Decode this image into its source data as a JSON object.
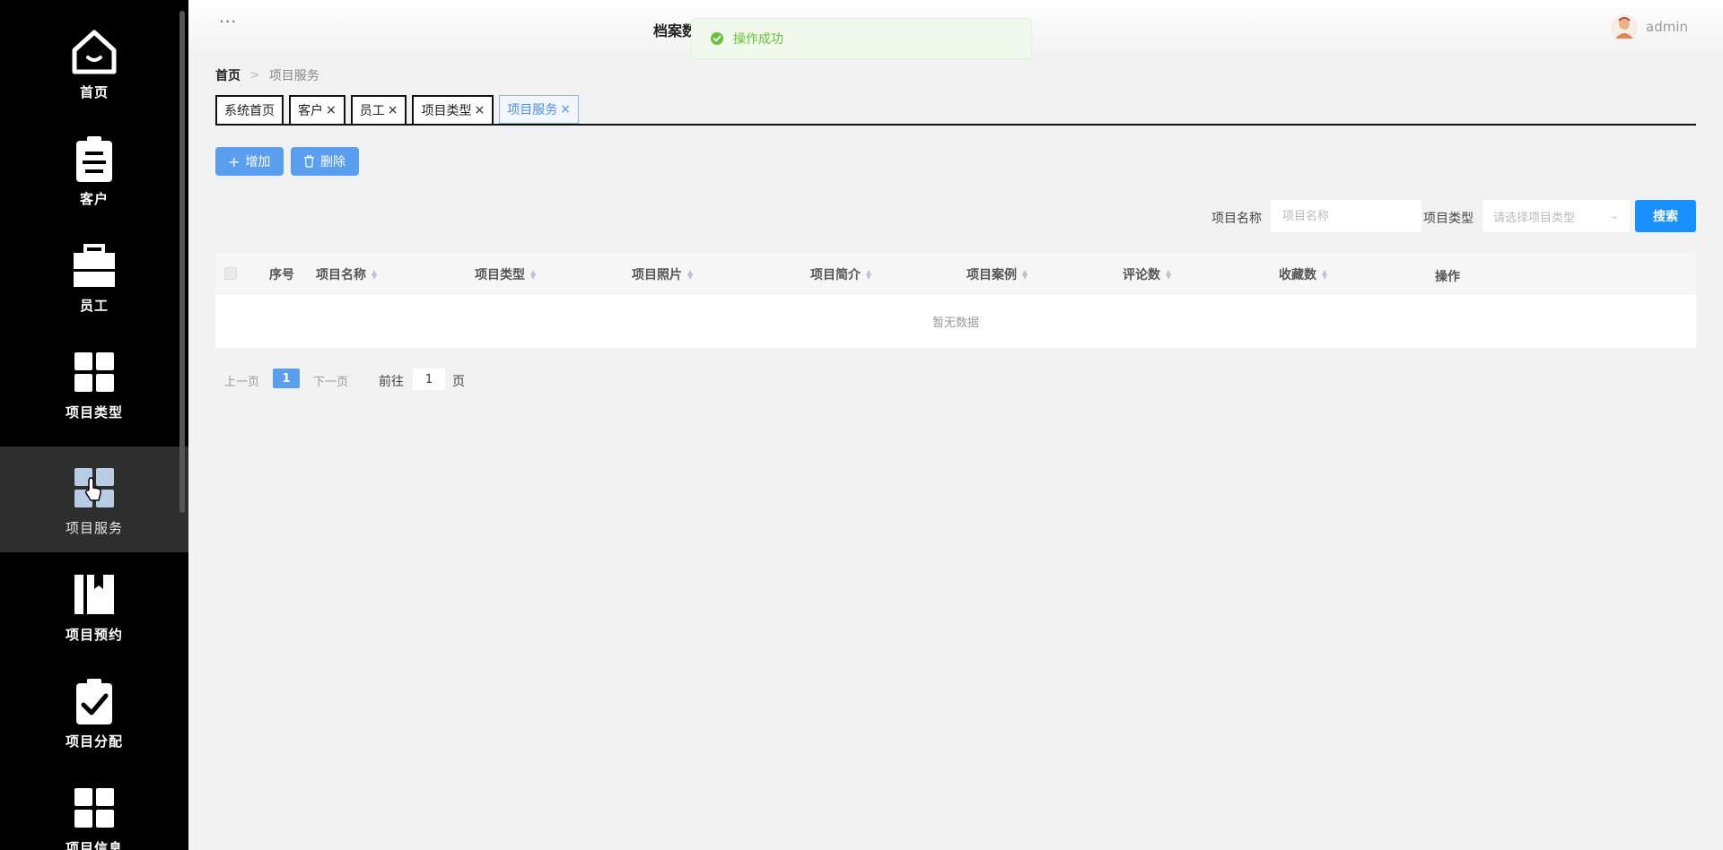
{
  "sidebar": {
    "items": [
      {
        "label": "首页",
        "icon": "home-icon"
      },
      {
        "label": "客户",
        "icon": "clipboard-icon"
      },
      {
        "label": "员工",
        "icon": "briefcase-icon"
      },
      {
        "label": "项目类型",
        "icon": "grid-icon"
      },
      {
        "label": "项目服务",
        "icon": "grid-icon"
      },
      {
        "label": "项目预约",
        "icon": "bookmark-icon"
      },
      {
        "label": "项目分配",
        "icon": "clipboard-check-icon"
      },
      {
        "label": "项目信息",
        "icon": "grid-icon"
      }
    ],
    "active_index": 4
  },
  "header": {
    "menu_dots": "···",
    "title": "档案数",
    "user": "admin"
  },
  "toast": {
    "message": "操作成功",
    "color": "#67c23a"
  },
  "breadcrumb": {
    "home": "首页",
    "separator": ">",
    "current": "项目服务"
  },
  "tabs": [
    {
      "label": "系统首页",
      "closable": false
    },
    {
      "label": "客户",
      "closable": true
    },
    {
      "label": "员工",
      "closable": true
    },
    {
      "label": "项目类型",
      "closable": true
    },
    {
      "label": "项目服务",
      "closable": true,
      "active": true
    }
  ],
  "tab_close_glyph": "×",
  "toolbar": {
    "add_label": "增加",
    "delete_label": "删除"
  },
  "search": {
    "name_label": "项目名称",
    "name_placeholder": "项目名称",
    "type_label": "项目类型",
    "type_placeholder": "请选择项目类型",
    "button_label": "搜索"
  },
  "table": {
    "columns": [
      "序号",
      "项目名称",
      "项目类型",
      "项目照片",
      "项目简介",
      "项目案例",
      "评论数",
      "收藏数",
      "操作"
    ],
    "empty_text": "暂无数据"
  },
  "pagination": {
    "prev": "上一页",
    "current_page": "1",
    "next": "下一页",
    "goto_label": "前往",
    "goto_value": "1",
    "page_suffix": "页"
  },
  "colors": {
    "sidebar_bg": "#000000",
    "primary_button": "#5a9ef0",
    "search_button": "#1890ff"
  }
}
